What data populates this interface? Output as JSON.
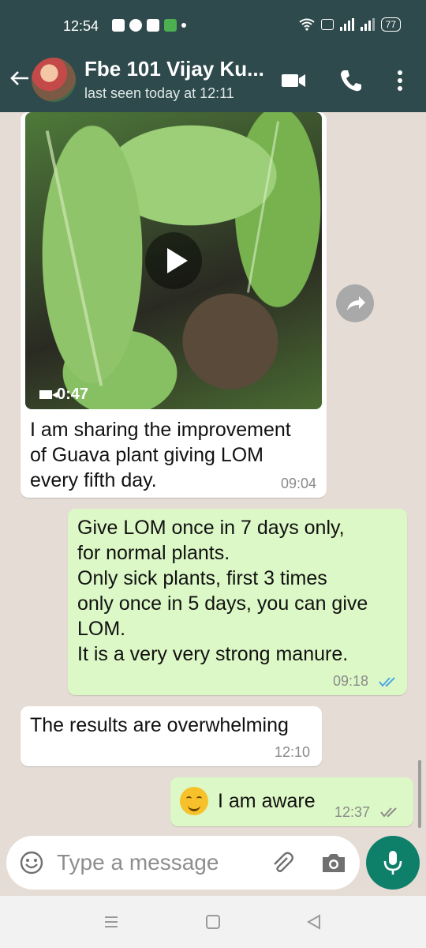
{
  "status_bar": {
    "time": "12:54",
    "battery": "77"
  },
  "header": {
    "contact_name": "Fbe 101 Vijay Ku...",
    "last_seen": "last seen today at 12:11",
    "icons": [
      "back-arrow-icon",
      "video-call-icon",
      "voice-call-icon",
      "more-options-icon"
    ]
  },
  "messages": [
    {
      "direction": "incoming",
      "type": "video",
      "video_duration": "0:47",
      "text": "I am sharing the improvement\nof Guava plant giving LOM\nevery fifth day.",
      "time": "09:04"
    },
    {
      "direction": "outgoing",
      "text": "Give LOM once in 7 days only,\nfor normal plants.\nOnly sick plants, first 3 times\nonly once in 5 days, you can give\nLOM.\nIt is a very very strong manure.",
      "time": "09:18",
      "status": "read"
    },
    {
      "direction": "incoming",
      "text": "The results are overwhelming",
      "time": "12:10"
    },
    {
      "direction": "outgoing",
      "emoji": "smiling-face",
      "text": "I am aware",
      "time": "12:37",
      "status": "delivered"
    }
  ],
  "composer": {
    "placeholder": "Type a message",
    "icons": [
      "emoji-icon",
      "attach-icon",
      "camera-icon",
      "mic-icon"
    ]
  },
  "colors": {
    "header": "#2f4a4c",
    "outgoing_bubble": "#dcf8c6",
    "chat_bg": "#e5ddd5",
    "mic_button": "#0e806a",
    "read_tick": "#4fa6e6"
  }
}
